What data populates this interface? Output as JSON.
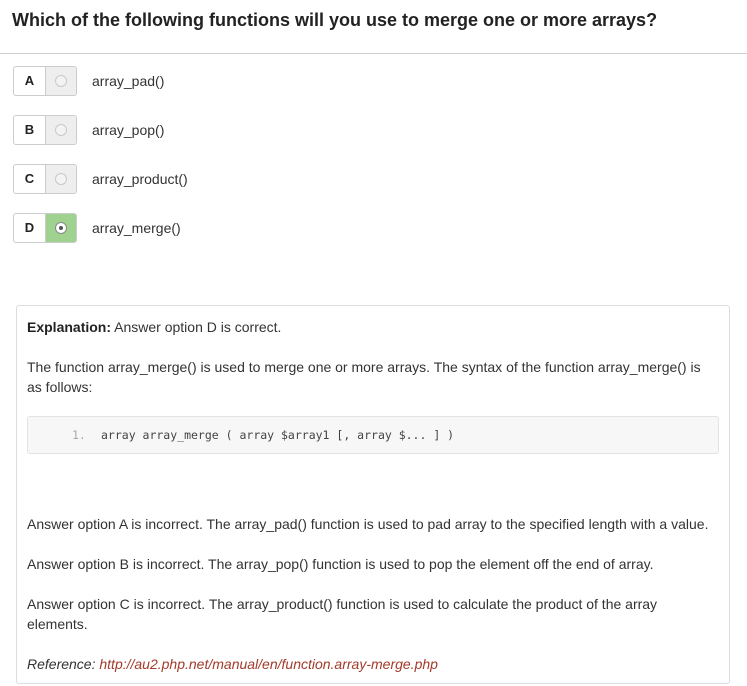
{
  "question": {
    "text": "Which of the following functions will you use to merge one or more arrays?"
  },
  "options": [
    {
      "letter": "A",
      "text": "array_pad()",
      "selected": false
    },
    {
      "letter": "B",
      "text": "array_pop()",
      "selected": false
    },
    {
      "letter": "C",
      "text": "array_product()",
      "selected": false
    },
    {
      "letter": "D",
      "text": "array_merge()",
      "selected": true
    }
  ],
  "explanation": {
    "label": "Explanation:",
    "summary": " Answer option D is correct.",
    "intro": "The function array_merge() is used to merge one or more arrays. The syntax of the function array_merge() is as follows:",
    "code": {
      "line_number": "1.",
      "source": "array array_merge ( array $array1 [, array $... ] )"
    },
    "option_a": "Answer option A is incorrect. The array_pad() function is used to pad array to the specified length with a value.",
    "option_b": "Answer option B is incorrect. The array_pop() function is used to pop the element off the end of array.",
    "option_c": "Answer option C is incorrect. The array_product() function is used to calculate the product of the array elements.",
    "reference_label": "Reference: ",
    "reference_url": "http://au2.php.net/manual/en/function.array-merge.php"
  },
  "colors": {
    "correct_highlight": "#9fd28f",
    "reference_link": "#a33a2a"
  }
}
